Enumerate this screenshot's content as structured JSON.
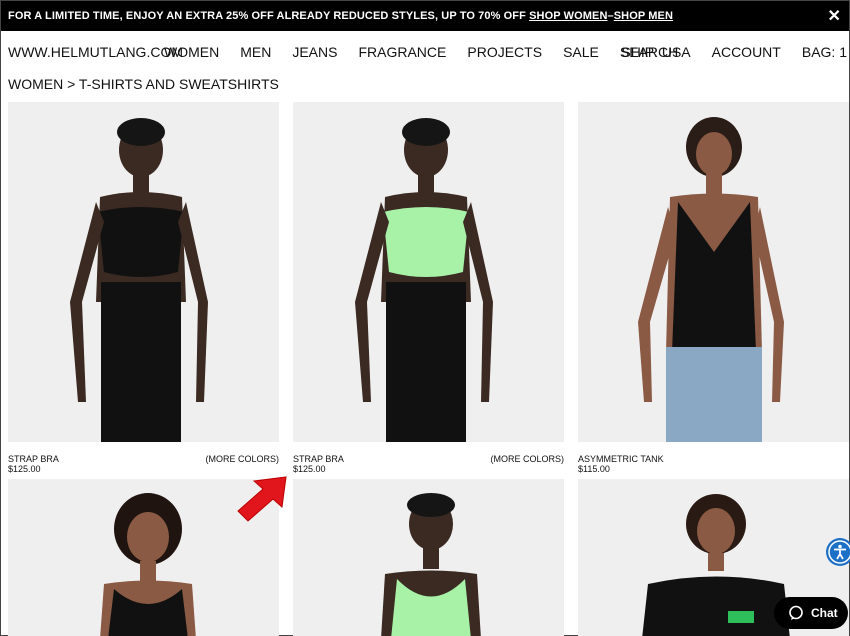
{
  "promo": {
    "text": "FOR A LIMITED TIME, ENJOY AN EXTRA 25% OFF ALREADY REDUCED STYLES, UP TO 70% OFF",
    "link_women": "SHOP WOMEN",
    "separator": " – ",
    "link_men": "SHOP MEN",
    "close": "✕"
  },
  "nav": {
    "logo": "WWW.HELMUTLANG.COM",
    "links": [
      "WOMEN",
      "MEN",
      "JEANS",
      "FRAGRANCE",
      "PROJECTS",
      "SALE",
      "SEARCH"
    ],
    "ship": "SHIP: USA",
    "account": "ACCOUNT",
    "bag": "BAG: 1"
  },
  "breadcrumb": "WOMEN > T-SHIRTS AND SWEATSHIRTS",
  "products": [
    {
      "name": "STRAP BRA",
      "price": "$125.00",
      "more": "(MORE COLORS)",
      "top_color": "#111111",
      "bottom_color": "#111111"
    },
    {
      "name": "STRAP BRA",
      "price": "$125.00",
      "more": "(MORE COLORS)",
      "top_color": "#a8f2a8",
      "bottom_color": "#111111"
    },
    {
      "name": "ASYMMETRIC TANK",
      "price": "$115.00",
      "more": "",
      "top_color": "#111111",
      "bottom_color": "#8aa7c4"
    }
  ],
  "chat": {
    "label": "Chat"
  },
  "colors": {
    "skin_dark": "#3a2a22",
    "skin_med": "#8a5a44",
    "annotation_arrow": "#e1161c",
    "accessibility": "#1d70c8"
  }
}
